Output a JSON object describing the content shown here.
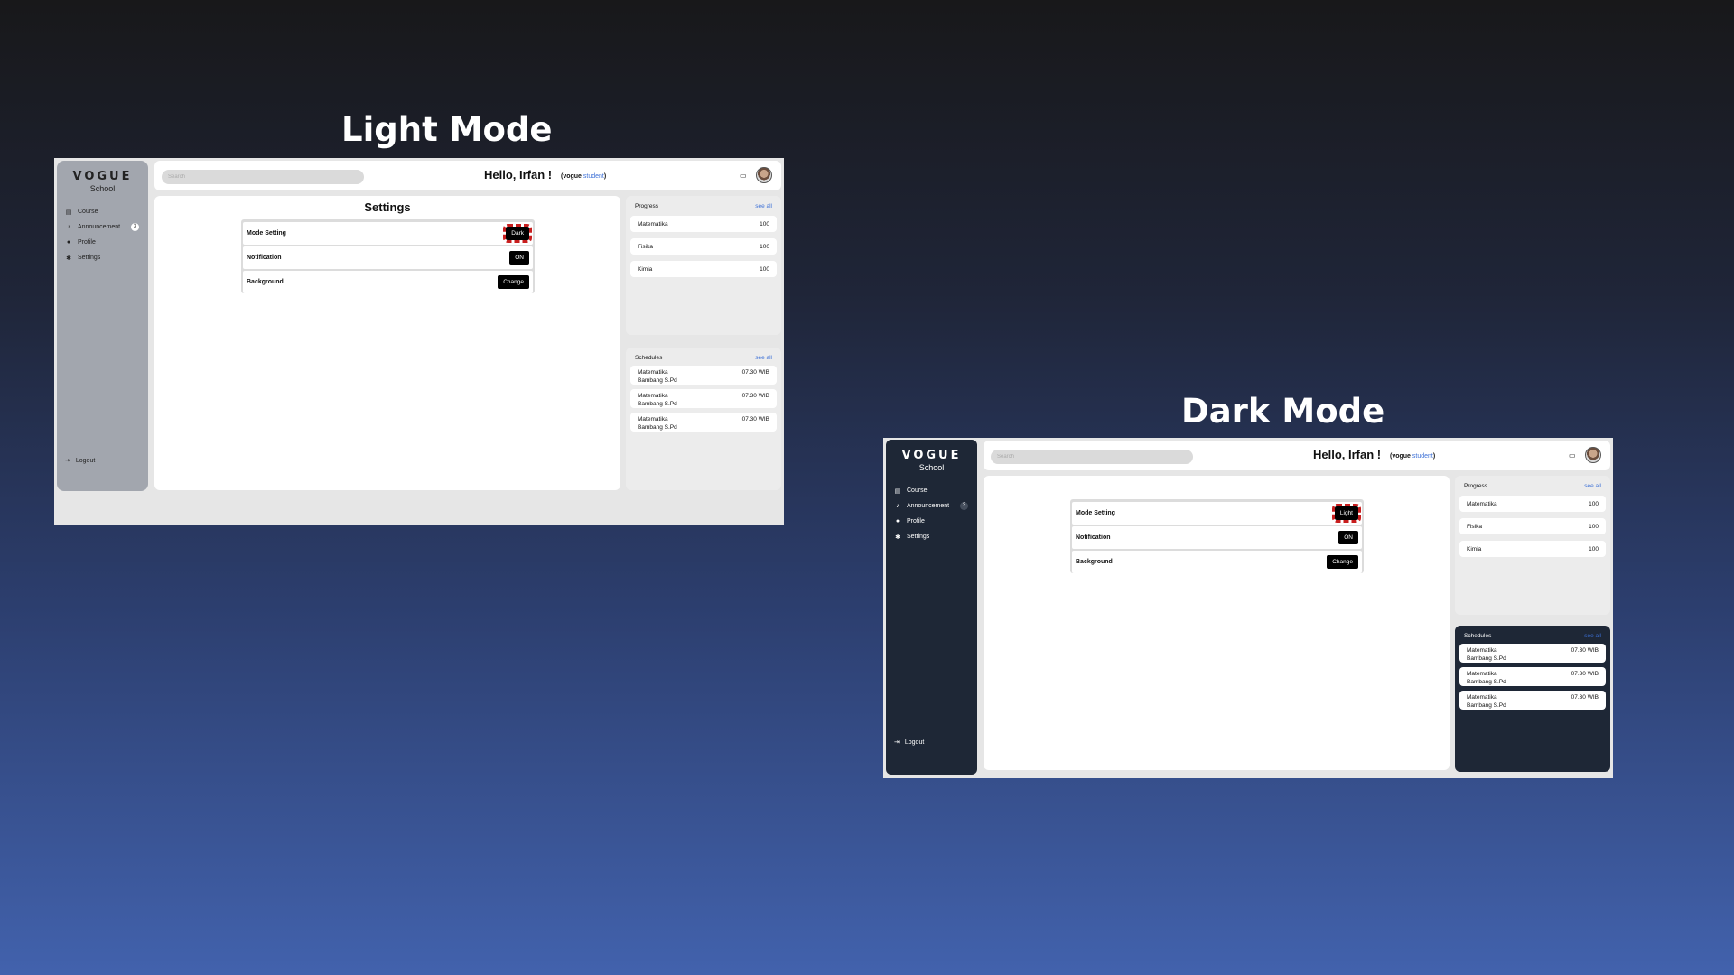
{
  "light_heading": "Light Mode",
  "dark_heading": "Dark Mode",
  "brand": {
    "name": "VOGUE",
    "sub": "School"
  },
  "nav": [
    {
      "label": "Course",
      "icon": "book-icon"
    },
    {
      "label": "Announcement",
      "icon": "bell-icon",
      "badge": "3"
    },
    {
      "label": "Profile",
      "icon": "user-circle-icon"
    },
    {
      "label": "Settings",
      "icon": "gear-icon"
    }
  ],
  "logout_label": "Logout",
  "search_placeholder": "Search",
  "greeting": "Hello, Irfan !",
  "role": {
    "prefix": "(vogue ",
    "highlight": "student",
    "suffix": ")"
  },
  "settings_title": "Settings",
  "settings": {
    "mode_label": "Mode Setting",
    "mode_btn_light_page": "Dark",
    "mode_btn_dark_page": "Light",
    "notif_label": "Notification",
    "notif_btn": "ON",
    "bg_label": "Background",
    "bg_btn": "Change"
  },
  "progress": {
    "title": "Progress",
    "see_all": "see all",
    "items": [
      {
        "subject": "Matematika",
        "score": "100"
      },
      {
        "subject": "Fisika",
        "score": "100"
      },
      {
        "subject": "Kimia",
        "score": "100"
      }
    ]
  },
  "schedules": {
    "title": "Schedules",
    "see_all": "see all",
    "items": [
      {
        "subject": "Matematika",
        "teacher": "Bambang S.Pd",
        "time": "07.30 WIB"
      },
      {
        "subject": "Matematika",
        "teacher": "Bambang S.Pd",
        "time": "07.30 WIB"
      },
      {
        "subject": "Matematika",
        "teacher": "Bambang S.Pd",
        "time": "07.30 WIB"
      }
    ]
  },
  "colors": {
    "accent": "#3b6fd6",
    "highlight_outline": "#c81e1e",
    "dark_sidebar": "#1e2736"
  }
}
